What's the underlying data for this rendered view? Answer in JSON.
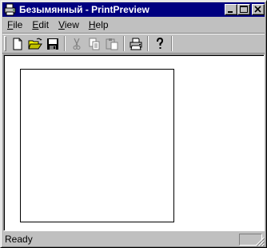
{
  "window": {
    "title": "Безымянный - PrintPreview",
    "app_icon": "printer-app-icon"
  },
  "caption_buttons": [
    "minimize-icon",
    "maximize-icon",
    "close-icon"
  ],
  "menu": {
    "items": [
      {
        "key": "F",
        "rest": "ile"
      },
      {
        "key": "E",
        "rest": "dit"
      },
      {
        "key": "V",
        "rest": "iew"
      },
      {
        "key": "H",
        "rest": "elp"
      }
    ]
  },
  "toolbar": {
    "buttons": [
      {
        "icon": "new-file-icon",
        "enabled": true
      },
      {
        "icon": "open-folder-icon",
        "enabled": true
      },
      {
        "icon": "save-disk-icon",
        "enabled": true
      },
      {
        "icon": "cut-icon",
        "enabled": false
      },
      {
        "icon": "copy-icon",
        "enabled": false
      },
      {
        "icon": "paste-icon",
        "enabled": false
      },
      {
        "icon": "print-icon",
        "enabled": true
      },
      {
        "icon": "help-icon",
        "enabled": true
      }
    ]
  },
  "status": {
    "text": "Ready"
  }
}
